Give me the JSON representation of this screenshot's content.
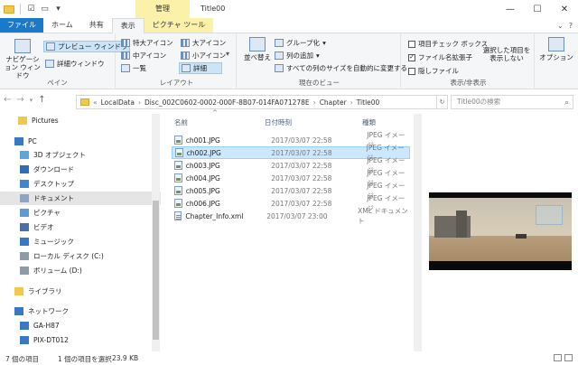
{
  "titlebar": {
    "context_tab": "管理",
    "title": "Title00",
    "minimize": "—",
    "maximize": "☐",
    "close": "✕"
  },
  "tabs": {
    "file": "ファイル",
    "home": "ホーム",
    "share": "共有",
    "view": "表示",
    "picture_tools": "ピクチャ ツール",
    "help": "?"
  },
  "ribbon": {
    "pane": {
      "nav_pane": "ナビゲーション ウィンドウ",
      "preview_pane": "プレビュー ウィンドウ",
      "details_pane": "詳細ウィンドウ",
      "group_label": "ペイン"
    },
    "layout": {
      "extra_large": "特大アイコン",
      "large": "大アイコン",
      "medium": "中アイコン",
      "small": "小アイコン",
      "list": "一覧",
      "details": "詳細",
      "group_label": "レイアウト"
    },
    "current_view": {
      "sort_by": "並べ替え",
      "group_by": "グループ化",
      "add_column": "列の追加",
      "fit_columns": "すべての列のサイズを自動的に変更する",
      "group_label": "現在のビュー"
    },
    "show_hide": {
      "item_checkboxes": "項目チェック ボックス",
      "file_extensions": "ファイル名拡張子",
      "hidden_items": "隠しファイル",
      "hide_selected": "選択した項目を 表示しない",
      "group_label": "表示/非表示",
      "item_checkboxes_checked": false,
      "file_extensions_checked": true,
      "hidden_items_checked": false
    },
    "options": "オプション"
  },
  "address": {
    "back": "←",
    "forward": "→",
    "up": "↑",
    "crumbs": [
      "LocalData",
      "Disc_002C0602-0002-000F-8B07-014FA071278E",
      "Chapter",
      "Title00"
    ],
    "search_placeholder": "Title00の検索"
  },
  "nav": {
    "items": [
      {
        "label": "Pictures",
        "icon": "pictures-folder-icon"
      },
      {
        "label": "PC",
        "icon": "pc-icon"
      },
      {
        "label": "3D オブジェクト",
        "icon": "3d-objects-icon"
      },
      {
        "label": "ダウンロード",
        "icon": "downloads-icon"
      },
      {
        "label": "デスクトップ",
        "icon": "desktop-icon"
      },
      {
        "label": "ドキュメント",
        "icon": "documents-icon"
      },
      {
        "label": "ピクチャ",
        "icon": "pictures-icon"
      },
      {
        "label": "ビデオ",
        "icon": "videos-icon"
      },
      {
        "label": "ミュージック",
        "icon": "music-icon"
      },
      {
        "label": "ローカル ディスク (C:)",
        "icon": "local-disk-icon"
      },
      {
        "label": "ボリューム (D:)",
        "icon": "volume-icon"
      },
      {
        "label": "ライブラリ",
        "icon": "library-icon"
      },
      {
        "label": "ネットワーク",
        "icon": "network-icon"
      },
      {
        "label": "GA-H87",
        "icon": "computer-icon"
      },
      {
        "label": "PIX-DT012",
        "icon": "computer-icon"
      }
    ]
  },
  "filelist": {
    "columns": {
      "name": "名前",
      "date": "日付時刻",
      "type": "種類"
    },
    "rows": [
      {
        "name": "ch001.JPG",
        "date": "2017/03/07 22:58",
        "type": "JPEG イメージ"
      },
      {
        "name": "ch002.JPG",
        "date": "2017/03/07 22:58",
        "type": "JPEG イメージ"
      },
      {
        "name": "ch003.JPG",
        "date": "2017/03/07 22:58",
        "type": "JPEG イメージ"
      },
      {
        "name": "ch004.JPG",
        "date": "2017/03/07 22:58",
        "type": "JPEG イメージ"
      },
      {
        "name": "ch005.JPG",
        "date": "2017/03/07 22:58",
        "type": "JPEG イメージ"
      },
      {
        "name": "ch006.JPG",
        "date": "2017/03/07 22:58",
        "type": "JPEG イメージ"
      },
      {
        "name": "Chapter_Info.xml",
        "date": "2017/03/07 23:00",
        "type": "XML ドキュメント"
      }
    ]
  },
  "status": {
    "item_count": "7 個の項目",
    "selected": "1 個の項目を選択",
    "size": "23.9 KB"
  }
}
